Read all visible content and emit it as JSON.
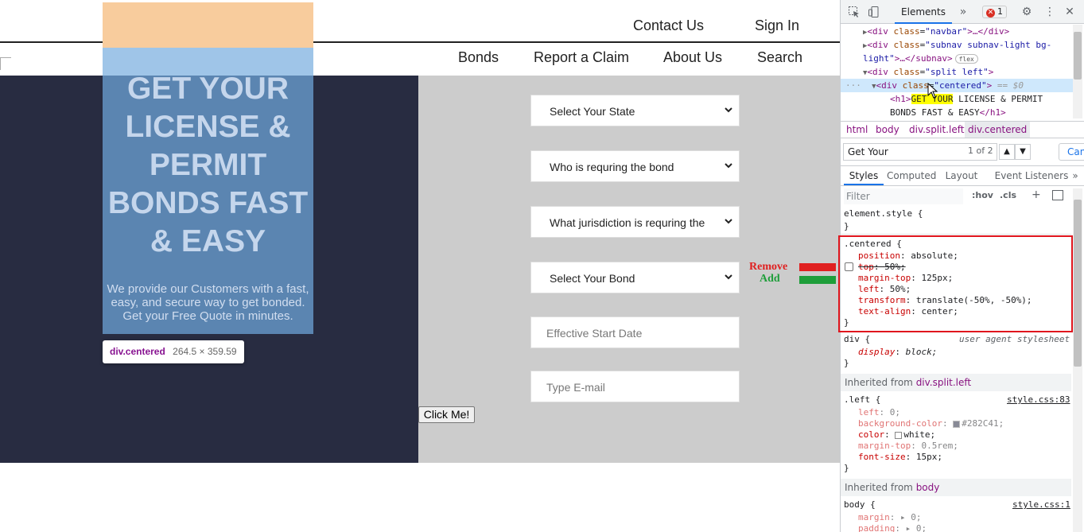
{
  "site": {
    "topnav": {
      "contact": "Contact Us",
      "signin": "Sign In"
    },
    "subnav": {
      "bonds": "Bonds",
      "claim": "Report a Claim",
      "about": "About Us",
      "search": "Search"
    },
    "hero": {
      "title": "GET YOUR LICENSE & PERMIT BONDS FAST & EASY",
      "text": "We provide our Customers with a fast, easy, and secure way to get bonded. Get your Free Quote in minutes."
    },
    "tooltip": {
      "name": "div.centered",
      "size": "264.5 × 359.59"
    },
    "form": {
      "state": "Select Your State",
      "who": "Who is requring the bond",
      "jurisdiction": "What jurisdiction is requring the bond",
      "bond": "Select Your Bond",
      "start_date_placeholder": "Effective Start Date",
      "email_placeholder": "Type E-mail",
      "button": "Click Me!"
    },
    "legend": {
      "remove": "Remove",
      "add": "Add"
    },
    "colors": {
      "left_bg": "#282C41",
      "right_bg": "#cccccc",
      "remove": "#e02020",
      "add": "#1e9e3a"
    }
  },
  "devtools": {
    "tab_elements": "Elements",
    "error_count": "1",
    "dom": {
      "l1_tag": "div",
      "l1_attr": "class",
      "l1_val": "\"navbar\"",
      "l1_rest": ">…</",
      "l2_attr": "class",
      "l2_val": "\"subnav subnav-light bg-",
      "l2_val2": "light\"",
      "l2_rest": ">…</",
      "flex": "flex",
      "l3_val": "\"split left\"",
      "l4_val": "\"centered\"",
      "l4_eq": "== $0",
      "l5_hl": "GET YOUR",
      "l5_rest": " LICENSE & PERMIT",
      "l6_text": "BONDS FAST & EASY",
      "tag_div": "div",
      "tag_h1": "h1",
      "attr_class": "class"
    },
    "breadcrumbs": [
      "html",
      "body",
      "div.split.left",
      "div.centered"
    ],
    "search": {
      "value": "Get Your",
      "count": "1 of 2",
      "cancel": "Cancel"
    },
    "style_tabs": [
      "Styles",
      "Computed",
      "Layout",
      "Event Listeners"
    ],
    "filter": {
      "placeholder": "Filter",
      "hov": ":hov",
      "cls": ".cls"
    },
    "rules": {
      "element_style": "element.style {",
      "close": "}",
      "centered_sel": ".centered {",
      "centered_props": [
        {
          "name": "position",
          "value": "absolute;"
        },
        {
          "name": "top",
          "value": "50%;"
        },
        {
          "name": "margin-top",
          "value": "125px;"
        },
        {
          "name": "left",
          "value": "50%;"
        },
        {
          "name": "transform",
          "value": "translate(-50%, -50%);"
        },
        {
          "name": "text-align",
          "value": "center;"
        }
      ],
      "div_sel": "div {",
      "div_ua": "user agent stylesheet",
      "div_prop": {
        "name": "display",
        "value": "block;"
      },
      "inherited_label": "Inherited from",
      "inherited_left_ref": "div.split.left",
      "left_sel": ".left {",
      "left_source": "style.css:83",
      "left_props": [
        {
          "name": "left",
          "value": "0;"
        },
        {
          "name": "background-color",
          "value": "#282C41;"
        },
        {
          "name": "color",
          "value": "white;"
        },
        {
          "name": "margin-top",
          "value": "0.5rem;"
        },
        {
          "name": "font-size",
          "value": "15px;"
        }
      ],
      "inherited_body_ref": "body",
      "body_sel": "body {",
      "body_source": "style.css:1",
      "body_props": [
        {
          "name": "margin",
          "value": "0;"
        },
        {
          "name": "padding",
          "value": "0;"
        }
      ]
    }
  }
}
